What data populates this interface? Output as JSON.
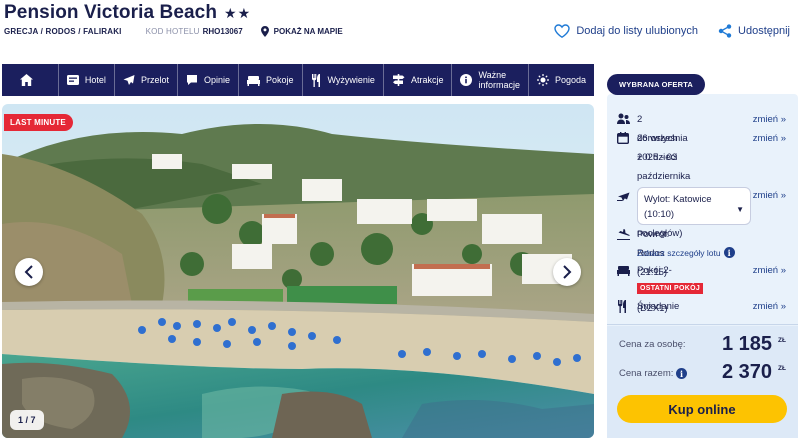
{
  "hotel": {
    "name": "Pension Victoria Beach",
    "stars": "★★",
    "breadcrumb": "GRECJA / RODOS / FALIRAKI",
    "code_label": "KOD HOTELU",
    "code_value": "RHO13067",
    "map_link": "POKAŻ NA MAPIE"
  },
  "header_actions": {
    "favorite": "Dodaj do listy ulubionych",
    "share": "Udostępnij"
  },
  "nav": {
    "home_icon": "home-icon",
    "items": [
      {
        "label": "Hotel",
        "icon": "hotel-card-icon"
      },
      {
        "label": "Przelot",
        "icon": "plane-icon"
      },
      {
        "label": "Opinie",
        "icon": "chat-bubble-icon"
      },
      {
        "label": "Pokoje",
        "icon": "bed-icon"
      },
      {
        "label": "Wyżywienie",
        "icon": "fork-knife-icon"
      },
      {
        "label": "Atrakcje",
        "icon": "signpost-icon"
      },
      {
        "label": "Ważne informacje",
        "label_line1": "Ważne",
        "label_line2": "informacje",
        "icon": "info-icon"
      },
      {
        "label": "Pogoda",
        "icon": "sun-icon"
      }
    ]
  },
  "gallery": {
    "badge": "LAST MINUTE",
    "counter": "1 / 7"
  },
  "offer": {
    "tag": "WYBRANA OFERTA",
    "change_label": "zmień",
    "travelers": "2 dorosłych + 0 dzieci",
    "dates_line1": "26 września 2025 - 03",
    "dates_line2": "października 2025",
    "dates_line3": "(7 nocległów)",
    "departure_line1": "Wylot: Katowice",
    "departure_line2": "(10:10)",
    "return": "Powrót: Rodos (21:15)",
    "flight_details": "Zobacz szczegóły lotu",
    "room": "Pokój 2-osobowy (DZX1)",
    "last_rooms": "OSTATNI POKÓJ",
    "board": "Śniadanie",
    "price_per_person_label": "Cena za osobę:",
    "price_per_person": "1 185",
    "price_total_label": "Cena razem:",
    "price_total": "2 370",
    "currency": "ZŁ",
    "buy_button": "Kup online"
  },
  "colors": {
    "navy": "#1b1f5e",
    "link_blue": "#1f3f8a",
    "accent_red": "#e52836",
    "cta_yellow": "#fdc301",
    "panel_bg": "#e9f2fb"
  }
}
